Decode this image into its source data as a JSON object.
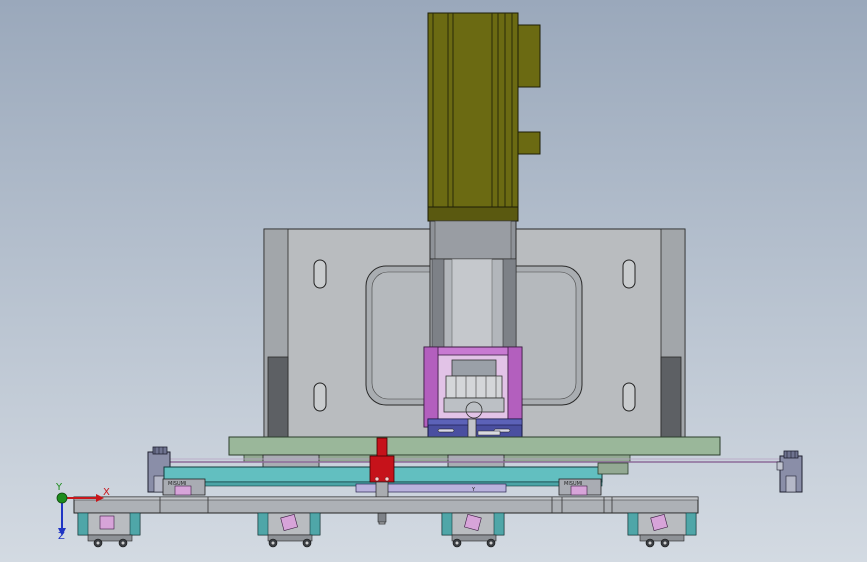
{
  "viewport": {
    "background_top": "#9aa8bb",
    "background_bottom": "#d3dae2"
  },
  "triad": {
    "x_label": "X",
    "y_label": "Y",
    "z_label": "Z",
    "x_color": "#c8171c",
    "y_color": "#1d8c1d",
    "z_color": "#1f35c4"
  },
  "model": {
    "motor_color": "#6b6a12",
    "plate_color": "#b9bcbf",
    "bracket_color": "#c87ad2",
    "clamp_color": "#4a4fa0",
    "rail_green": "#9ab79a",
    "rail_teal": "#62bfc0",
    "tool_red": "#c6121a",
    "block_marks": [
      "MISUMI",
      "MISUMI"
    ]
  }
}
